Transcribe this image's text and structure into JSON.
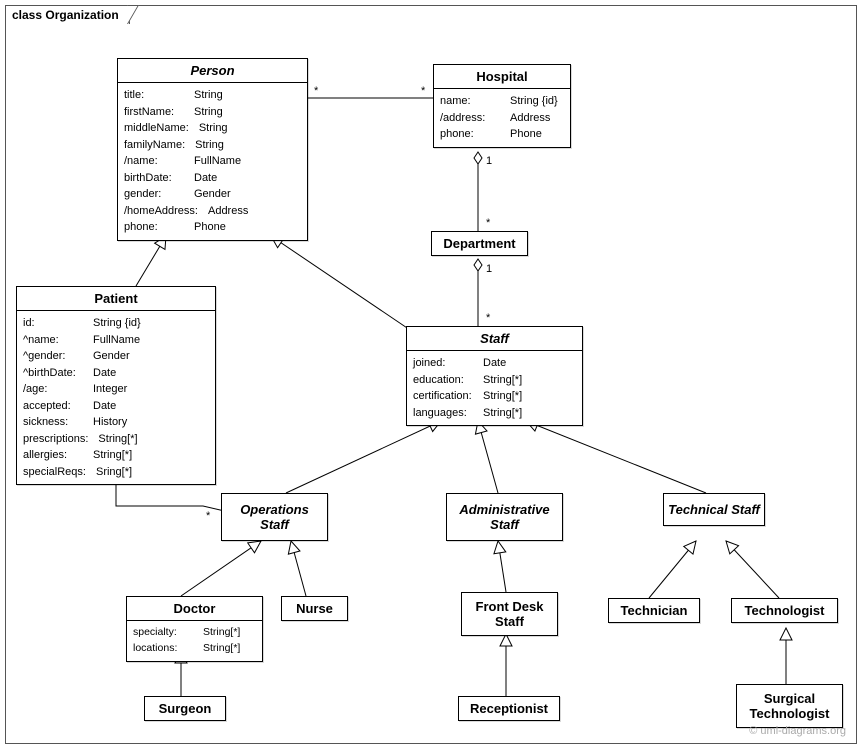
{
  "frameTitle": "class Organization",
  "watermark": "© uml-diagrams.org",
  "classes": {
    "person": {
      "title": "Person",
      "attrs": [
        {
          "name": "title:",
          "type": "String"
        },
        {
          "name": "firstName:",
          "type": "String"
        },
        {
          "name": "middleName:",
          "type": "String"
        },
        {
          "name": "familyName:",
          "type": "String"
        },
        {
          "name": "/name:",
          "type": "FullName"
        },
        {
          "name": "birthDate:",
          "type": "Date"
        },
        {
          "name": "gender:",
          "type": "Gender"
        },
        {
          "name": "/homeAddress:",
          "type": "Address"
        },
        {
          "name": "phone:",
          "type": "Phone"
        }
      ]
    },
    "hospital": {
      "title": "Hospital",
      "attrs": [
        {
          "name": "name:",
          "type": "String {id}"
        },
        {
          "name": "/address:",
          "type": "Address"
        },
        {
          "name": "phone:",
          "type": "Phone"
        }
      ]
    },
    "department": {
      "title": "Department"
    },
    "patient": {
      "title": "Patient",
      "attrs": [
        {
          "name": "id:",
          "type": "String {id}"
        },
        {
          "name": "^name:",
          "type": "FullName"
        },
        {
          "name": "^gender:",
          "type": "Gender"
        },
        {
          "name": "^birthDate:",
          "type": "Date"
        },
        {
          "name": "/age:",
          "type": "Integer"
        },
        {
          "name": "accepted:",
          "type": "Date"
        },
        {
          "name": "sickness:",
          "type": "History"
        },
        {
          "name": "prescriptions:",
          "type": "String[*]"
        },
        {
          "name": "allergies:",
          "type": "String[*]"
        },
        {
          "name": "specialReqs:",
          "type": "Sring[*]"
        }
      ]
    },
    "staff": {
      "title": "Staff",
      "attrs": [
        {
          "name": "joined:",
          "type": "Date"
        },
        {
          "name": "education:",
          "type": "String[*]"
        },
        {
          "name": "certification:",
          "type": "String[*]"
        },
        {
          "name": "languages:",
          "type": "String[*]"
        }
      ]
    },
    "opsStaff": {
      "title": "Operations Staff"
    },
    "adminStaff": {
      "title": "Administrative Staff"
    },
    "techStaff": {
      "title": "Technical Staff"
    },
    "doctor": {
      "title": "Doctor",
      "attrs": [
        {
          "name": "specialty:",
          "type": "String[*]"
        },
        {
          "name": "locations:",
          "type": "String[*]"
        }
      ]
    },
    "nurse": {
      "title": "Nurse"
    },
    "frontDesk": {
      "title": "Front Desk Staff"
    },
    "receptionist": {
      "title": "Receptionist"
    },
    "technician": {
      "title": "Technician"
    },
    "technologist": {
      "title": "Technologist"
    },
    "surgicalTech": {
      "title": "Surgical Technologist"
    }
  },
  "labels": {
    "star": "*",
    "one": "1"
  }
}
